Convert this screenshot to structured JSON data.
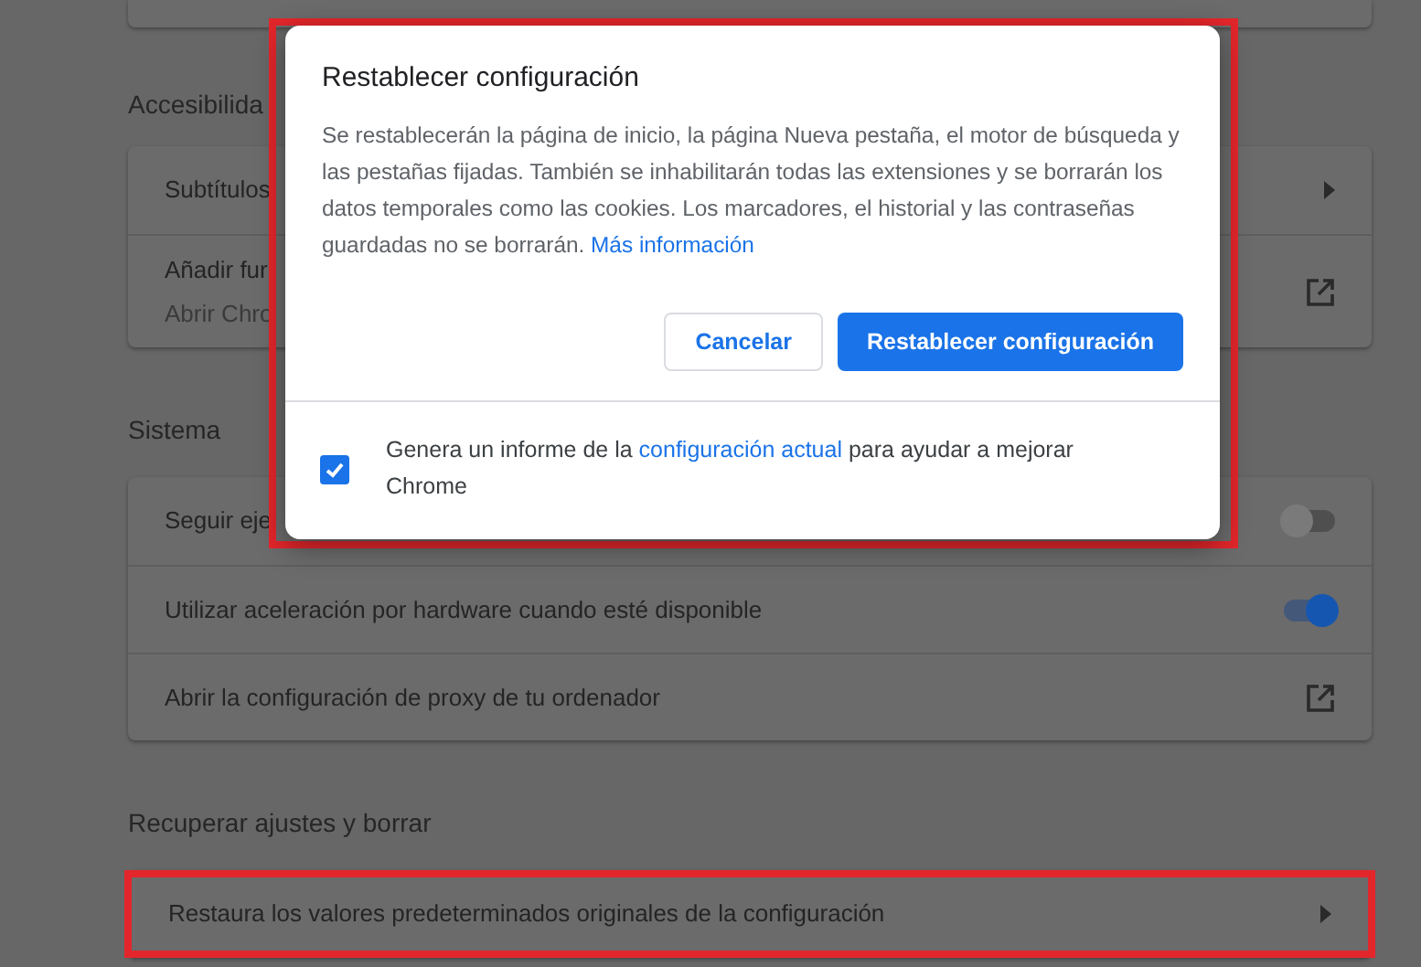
{
  "sections": [
    {
      "heading": "Accesibilida",
      "rows": [
        {
          "kind": "arrow",
          "label": "Subtítulos",
          "highlighted": false
        },
        {
          "kind": "external",
          "label": "Añadir fur",
          "sublabel": "Abrir Chro",
          "highlighted": false
        }
      ]
    },
    {
      "heading": "Sistema",
      "rows": [
        {
          "kind": "toggle",
          "label": "Seguir eje",
          "on": false,
          "highlighted": false
        },
        {
          "kind": "toggle",
          "label": "Utilizar aceleración por hardware cuando esté disponible",
          "on": true,
          "highlighted": false
        },
        {
          "kind": "external",
          "label": "Abrir la configuración de proxy de tu ordenador",
          "highlighted": false
        }
      ]
    },
    {
      "heading": "Recuperar ajustes y borrar",
      "rows": [
        {
          "kind": "arrow",
          "label": "Restaura los valores predeterminados originales de la configuración",
          "highlighted": true
        }
      ]
    }
  ],
  "dialog": {
    "title": "Restablecer configuración",
    "highlighted": true,
    "body": "Se restablecerán la página de inicio, la página Nueva pestaña, el motor de búsqueda y las pestañas fijadas. También se inhabilitarán todas las extensiones y se borrarán los datos temporales como las cookies. Los marcadores, el historial y las contraseñas guardadas no se borrarán.",
    "body_link": "Más información",
    "buttons": [
      {
        "label": "Cancelar",
        "kind": "secondary"
      },
      {
        "label": "Restablecer configuración",
        "kind": "primary"
      }
    ],
    "report": {
      "checked": true,
      "text_before": "Genera un informe de la",
      "link": "configuración actual",
      "text_after": "para ayudar a mejorar Chrome"
    }
  }
}
